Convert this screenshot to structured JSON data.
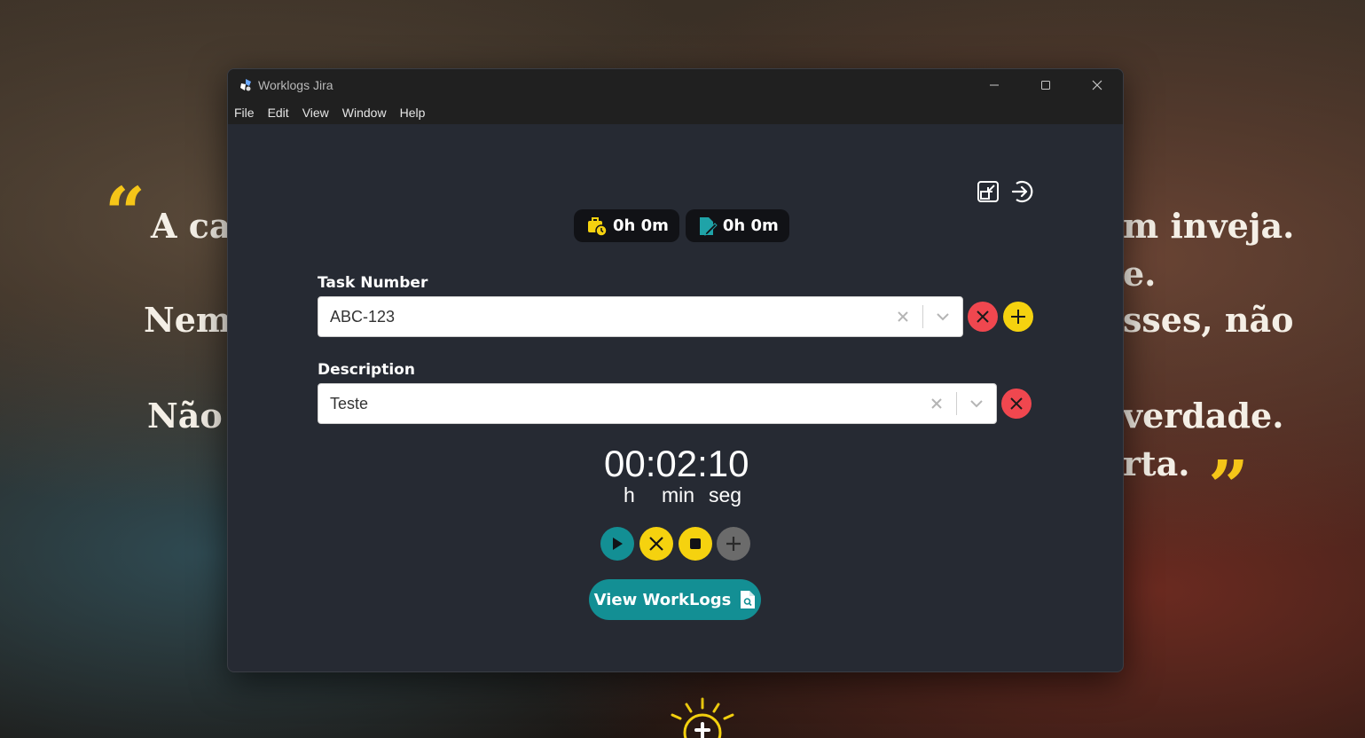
{
  "background": {
    "lines": [
      {
        "id": "l1",
        "left_text": "A ca",
        "right_text": "m inveja."
      },
      {
        "id": "l2",
        "left_text": "",
        "right_text": "e."
      },
      {
        "id": "l3",
        "left_text": "Nem",
        "right_text": "sses, não"
      },
      {
        "id": "l4",
        "left_text": "Não",
        "right_text": "verdade."
      },
      {
        "id": "l5",
        "left_text": "",
        "right_text": "rta."
      }
    ],
    "open_quote": "“",
    "close_quote": "”"
  },
  "window": {
    "title": "Worklogs Jira",
    "menu": [
      "File",
      "Edit",
      "View",
      "Window",
      "Help"
    ]
  },
  "badges": {
    "logged": "0h 0m",
    "edited": "0h 0m"
  },
  "task": {
    "label": "Task Number",
    "value": "ABC-123"
  },
  "description": {
    "label": "Description",
    "value": "Teste"
  },
  "timer": {
    "display": "00:02:10",
    "unit_h": "h",
    "unit_min": "min",
    "unit_seg": "seg"
  },
  "actions": {
    "view_worklogs": "View WorkLogs"
  },
  "colors": {
    "accent_yellow": "#f5d20f",
    "accent_teal": "#138f94",
    "danger_red": "#f0474f",
    "neutral_gray": "#6b6b6b",
    "window_bg": "#262a33"
  }
}
